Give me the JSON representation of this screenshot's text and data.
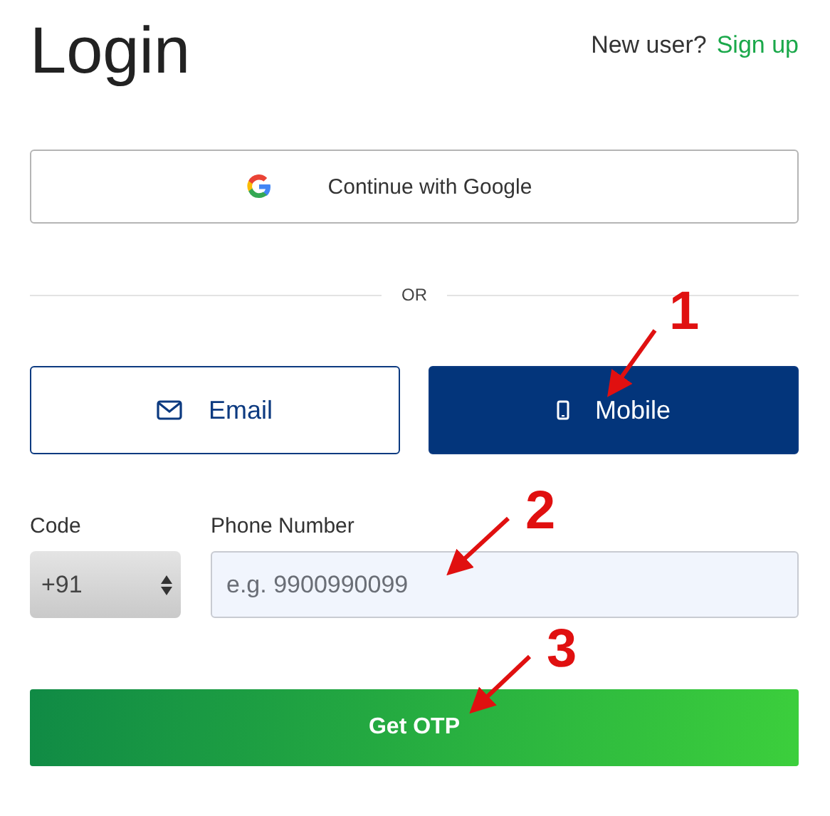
{
  "title": "Login",
  "signup": {
    "prompt": "New user?",
    "link": "Sign up"
  },
  "google_button": "Continue with Google",
  "divider": "OR",
  "tabs": [
    {
      "label": "Email",
      "kind": "email",
      "selected": false
    },
    {
      "label": "Mobile",
      "kind": "mobile",
      "selected": true
    }
  ],
  "code_field": {
    "label": "Code",
    "value": "+91"
  },
  "phone_field": {
    "label": "Phone Number",
    "placeholder": "e.g. 9900990099"
  },
  "submit_button": "Get OTP",
  "annotations": [
    {
      "text": "1"
    },
    {
      "text": "2"
    },
    {
      "text": "3"
    }
  ]
}
